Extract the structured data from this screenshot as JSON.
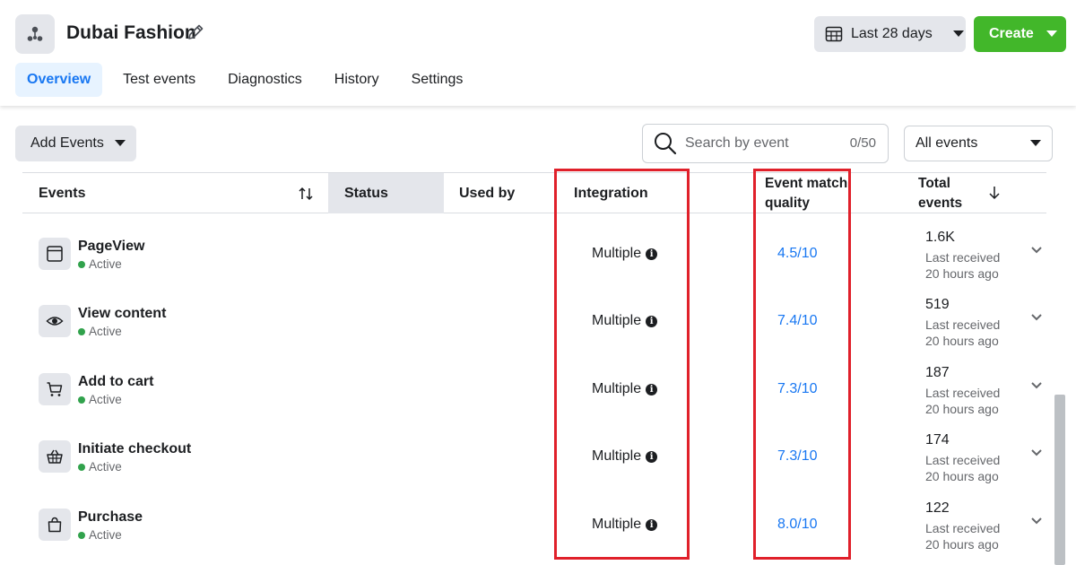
{
  "header": {
    "dataset_name": "Dubai Fashion",
    "date_range": "Last 28 days",
    "create_label": "Create"
  },
  "tabs": [
    {
      "label": "Overview",
      "active": true
    },
    {
      "label": "Test events",
      "active": false
    },
    {
      "label": "Diagnostics",
      "active": false
    },
    {
      "label": "History",
      "active": false
    },
    {
      "label": "Settings",
      "active": false
    }
  ],
  "toolbar": {
    "add_events_label": "Add Events",
    "search_placeholder": "Search by event",
    "search_value": "",
    "search_count": "0/50",
    "filter_value": "All events"
  },
  "table": {
    "columns": {
      "events": "Events",
      "status": "Status",
      "used_by": "Used by",
      "integration": "Integration",
      "emq_line1": "Event match",
      "emq_line2": "quality",
      "total_line1": "Total",
      "total_line2": "events"
    },
    "rows": [
      {
        "name": "PageView",
        "icon": "page-icon",
        "status": "Active",
        "integration": "Multiple",
        "emq": "4.5/10",
        "total": "1.6K",
        "received_line1": "Last received",
        "received_line2": "20 hours ago"
      },
      {
        "name": "View content",
        "icon": "eye-icon",
        "status": "Active",
        "integration": "Multiple",
        "emq": "7.4/10",
        "total": "519",
        "received_line1": "Last received",
        "received_line2": "20 hours ago"
      },
      {
        "name": "Add to cart",
        "icon": "cart-icon",
        "status": "Active",
        "integration": "Multiple",
        "emq": "7.3/10",
        "total": "187",
        "received_line1": "Last received",
        "received_line2": "20 hours ago"
      },
      {
        "name": "Initiate checkout",
        "icon": "basket-icon",
        "status": "Active",
        "integration": "Multiple",
        "emq": "7.3/10",
        "total": "174",
        "received_line1": "Last received",
        "received_line2": "20 hours ago"
      },
      {
        "name": "Purchase",
        "icon": "bag-icon",
        "status": "Active",
        "integration": "Multiple",
        "emq": "8.0/10",
        "total": "122",
        "received_line1": "Last received",
        "received_line2": "20 hours ago"
      }
    ]
  },
  "colors": {
    "accent": "#1877f2",
    "create_green": "#42b72a",
    "active_green": "#31a24c",
    "highlight_red": "#e0202a"
  }
}
